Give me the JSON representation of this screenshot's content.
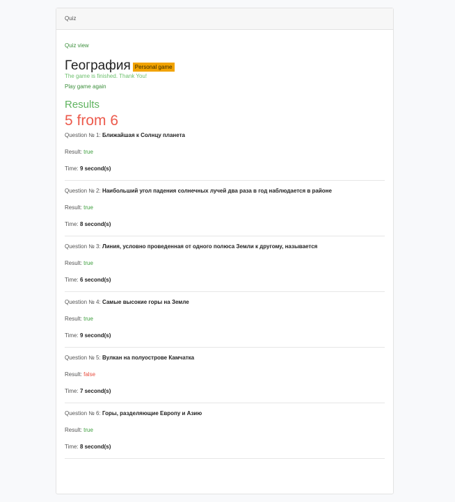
{
  "header": {
    "title": "Quiz"
  },
  "nav": {
    "quiz_view": "Quiz view"
  },
  "quiz": {
    "name": "География",
    "badge": "Personal game",
    "finished_message": "The game is finished. Thank You!",
    "play_again": "Play game again"
  },
  "results": {
    "heading": "Results",
    "score": "5 from 6",
    "question_prefix": "Question № ",
    "result_label": "Result: ",
    "time_label": "Time: ",
    "items": [
      {
        "num": "1:",
        "text": "Ближайшая к Солнцу планета",
        "result": "true",
        "time": "9 second(s)"
      },
      {
        "num": "2:",
        "text": "Наибольший угол падения солнечных лучей два раза в год наблюдается в районе",
        "result": "true",
        "time": "8 second(s)"
      },
      {
        "num": "3:",
        "text": "Линия, условно проведенная от одного полюса Земли к другому, называется",
        "result": "true",
        "time": "6 second(s)"
      },
      {
        "num": "4:",
        "text": "Самые высокие горы на Земле",
        "result": "true",
        "time": "9 second(s)"
      },
      {
        "num": "5:",
        "text": "Вулкан на полуострове Камчатка",
        "result": "false",
        "time": "7 second(s)"
      },
      {
        "num": "6:",
        "text": "Горы, разделяющие Европу и Азию",
        "result": "true",
        "time": "8 second(s)"
      }
    ]
  }
}
